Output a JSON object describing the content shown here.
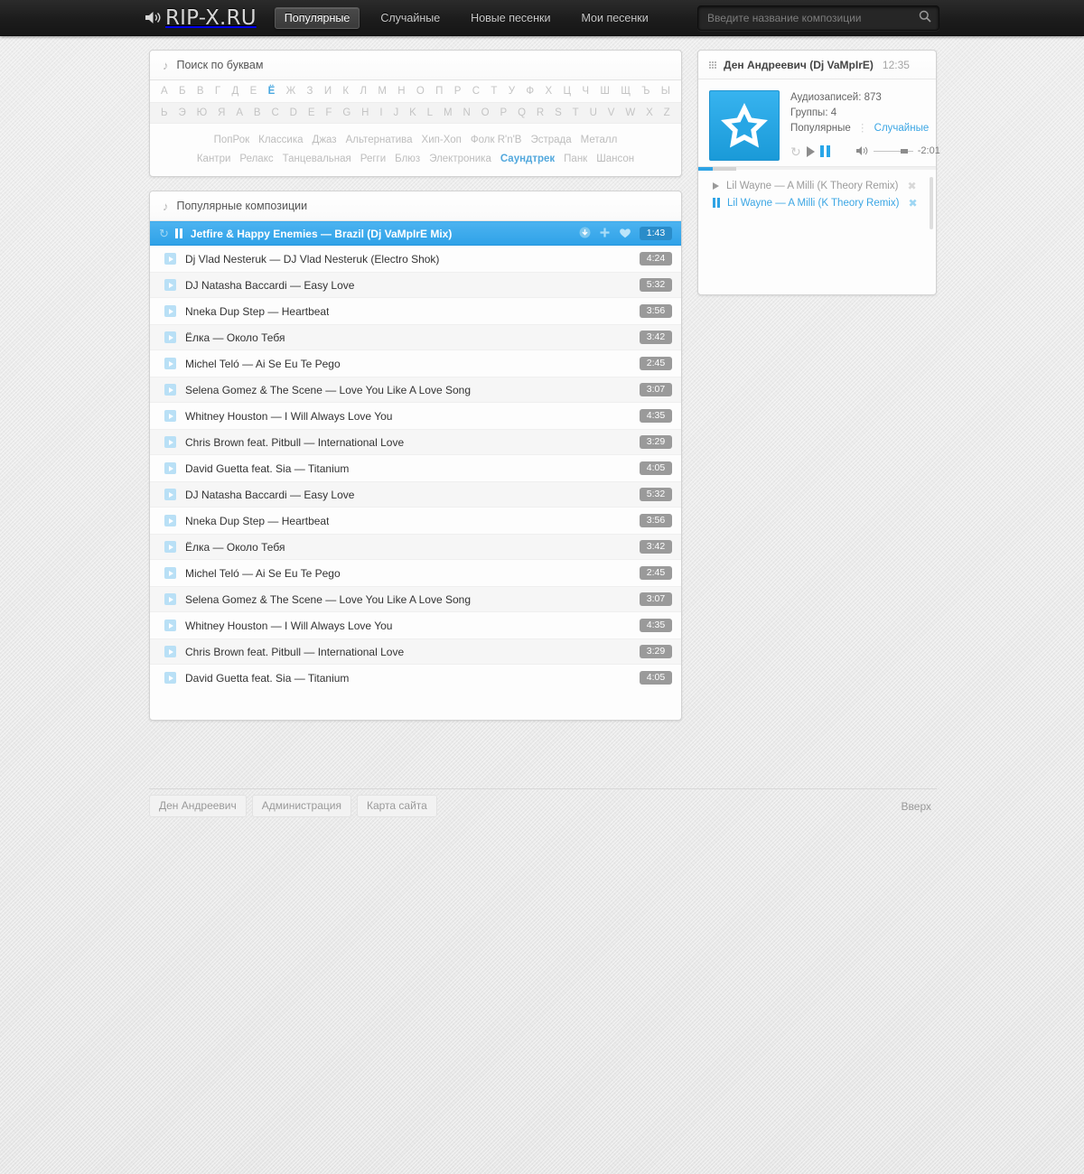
{
  "header": {
    "logo_text": "RIP-X.RU",
    "logo_icon": "speaker-icon",
    "nav": [
      {
        "label": "Популярные",
        "active": true
      },
      {
        "label": "Случайные",
        "active": false
      },
      {
        "label": "Новые песенки",
        "active": false
      },
      {
        "label": "Мои песенки",
        "active": false
      }
    ],
    "search": {
      "placeholder": "Введите название композиции",
      "value": "",
      "icon": "search-icon"
    }
  },
  "letters_panel": {
    "title": "Поиск по буквам",
    "icon": "music-note-icon",
    "row1": [
      "А",
      "Б",
      "В",
      "Г",
      "Д",
      "Е",
      "Ё",
      "Ж",
      "З",
      "И",
      "К",
      "Л",
      "М",
      "Н",
      "О",
      "П",
      "Р",
      "С",
      "Т",
      "У",
      "Ф",
      "Х",
      "Ц",
      "Ч",
      "Ш",
      "Щ",
      "Ъ",
      "Ы"
    ],
    "row1_active": "Ё",
    "row2": [
      "Ь",
      "Э",
      "Ю",
      "Я",
      "A",
      "B",
      "C",
      "D",
      "E",
      "F",
      "G",
      "H",
      "I",
      "J",
      "K",
      "L",
      "M",
      "N",
      "O",
      "P",
      "Q",
      "R",
      "S",
      "T",
      "U",
      "V",
      "W",
      "X",
      "Z"
    ],
    "row2_active": "",
    "genres_line1": [
      "ПопРок",
      "Классика",
      "Джаз",
      "Альтернатива",
      "Хип-Хоп",
      "Фолк R'n'B",
      "Эстрада",
      "Металл"
    ],
    "genres_line2": [
      "Кантри",
      "Релакс",
      "Танцевальная",
      "Регги",
      "Блюз",
      "Электроника",
      "Саундтрек",
      "Панк",
      "Шансон"
    ],
    "genre_active": "Саундтрек"
  },
  "tracks_panel": {
    "title": "Популярные композиции",
    "icon": "music-note-icon",
    "current": {
      "name": "Jetfire & Happy Enemies — Brazil (Dj VaMpIrE Mix)",
      "duration": "1:43",
      "icons": [
        "refresh-icon",
        "pause-icon",
        "download-icon",
        "plus-icon",
        "heart-icon"
      ]
    },
    "tracks": [
      {
        "name": "Dj Vlad Nesteruk — DJ Vlad Nesteruk (Electro Shok)",
        "duration": "4:24"
      },
      {
        "name": "DJ Natasha Baccardi — Easy Love",
        "duration": "5:32"
      },
      {
        "name": "Nneka Dup Step — Heartbeat",
        "duration": "3:56"
      },
      {
        "name": "Ёлка — Около Тебя",
        "duration": "3:42"
      },
      {
        "name": "Michel Teló — Ai Se Eu Te Pego",
        "duration": "2:45"
      },
      {
        "name": "Selena Gomez & The Scene — Love You Like A Love Song",
        "duration": "3:07"
      },
      {
        "name": "Whitney Houston — I Will Always Love You",
        "duration": "4:35"
      },
      {
        "name": "Chris Brown feat. Pitbull — International Love",
        "duration": "3:29"
      },
      {
        "name": "David Guetta feat. Sia — Titanium",
        "duration": "4:05"
      },
      {
        "name": "DJ Natasha Baccardi — Easy Love",
        "duration": "5:32"
      },
      {
        "name": "Nneka Dup Step — Heartbeat",
        "duration": "3:56"
      },
      {
        "name": "Ёлка — Около Тебя",
        "duration": "3:42"
      },
      {
        "name": "Michel Teló — Ai Se Eu Te Pego",
        "duration": "2:45"
      },
      {
        "name": "Selena Gomez & The Scene — Love You Like A Love Song",
        "duration": "3:07"
      },
      {
        "name": "Whitney Houston — I Will Always Love You",
        "duration": "4:35"
      },
      {
        "name": "Chris Brown feat. Pitbull — International Love",
        "duration": "3:29"
      },
      {
        "name": "David Guetta feat. Sia — Titanium",
        "duration": "4:05"
      }
    ]
  },
  "sidebar": {
    "user_name": "Ден Андреевич (Dj VaMpIrE)",
    "user_time": "12:35",
    "grid_icon": "grid-icon",
    "avatar_icon": "star-avatar",
    "audio_count_label": "Аудиозаписей: 873",
    "groups_label": "Группы: 4",
    "filter_popular": "Популярные",
    "filter_random": "Случайные",
    "controls": [
      "refresh-icon",
      "play-icon",
      "pause-icon",
      "volume-icon"
    ],
    "time_remaining": "-2:01",
    "playlist": [
      {
        "name": "Lil Wayne — A Milli (K Theory Remix)",
        "state": "play",
        "active": false
      },
      {
        "name": "Lil Wayne — A Milli (K Theory Remix)",
        "state": "pause",
        "active": true
      }
    ]
  },
  "footer": {
    "links": [
      "Ден Андреевич",
      "Администрация",
      "Карта сайта"
    ],
    "up_label": "Вверх"
  },
  "colors": {
    "accent": "#2ea3e5",
    "accent_light": "#4cb3f0",
    "duration_bg": "#9a9a9a",
    "header_bg": "#1c1c1c"
  }
}
